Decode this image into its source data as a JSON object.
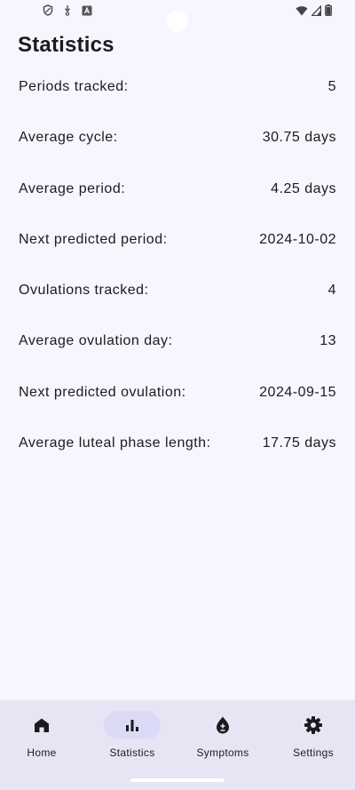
{
  "page": {
    "title": "Statistics"
  },
  "stats": [
    {
      "label": "Periods tracked:",
      "value": "5"
    },
    {
      "label": "Average cycle:",
      "value": "30.75 days"
    },
    {
      "label": "Average period:",
      "value": "4.25 days"
    },
    {
      "label": "Next predicted period:",
      "value": "2024-10-02"
    },
    {
      "label": "Ovulations tracked:",
      "value": "4"
    },
    {
      "label": "Average ovulation day:",
      "value": "13"
    },
    {
      "label": "Next predicted ovulation:",
      "value": "2024-09-15"
    },
    {
      "label": "Average luteal phase length:",
      "value": "17.75 days"
    }
  ],
  "nav": {
    "items": [
      {
        "label": "Home",
        "icon": "home-icon",
        "active": false
      },
      {
        "label": "Statistics",
        "icon": "bar-chart-icon",
        "active": true
      },
      {
        "label": "Symptoms",
        "icon": "drop-plus-minus-icon",
        "active": false
      },
      {
        "label": "Settings",
        "icon": "gear-icon",
        "active": false
      }
    ]
  },
  "colors": {
    "background": "#f7f5fd",
    "nav_background": "#e7e5f3",
    "active_pill": "#dcdbf7",
    "text": "#1b1b1f"
  }
}
